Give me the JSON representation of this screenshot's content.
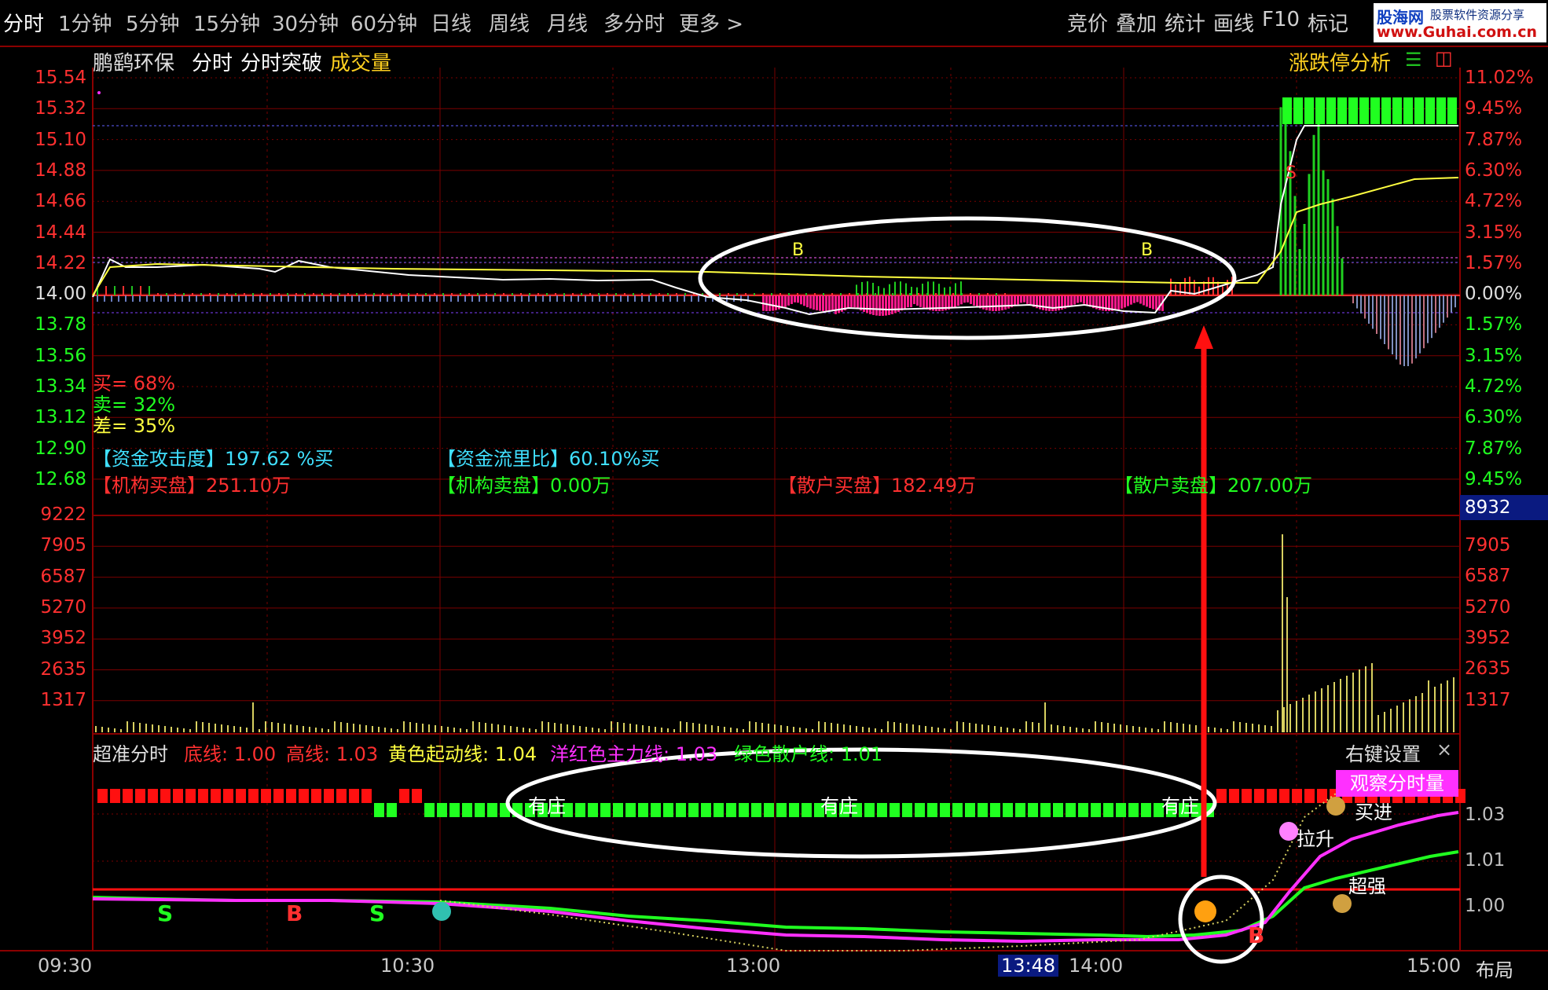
{
  "tabs": [
    "分时",
    "1分钟",
    "5分钟",
    "15分钟",
    "30分钟",
    "60分钟",
    "日线",
    "周线",
    "月线",
    "多分时",
    "更多 >"
  ],
  "toolbar": [
    "竞价",
    "叠加",
    "统计",
    "画线",
    "F10",
    "标记"
  ],
  "logo": {
    "line1": "股海网",
    "line1b": "股票软件资源分享",
    "line2": "www.Guhai.com.cn"
  },
  "chart_header": {
    "stock": "鹏鹞环保",
    "view": "分时",
    "indicator": "分时突破",
    "volume": "成交量",
    "right_label": "涨跌停分析"
  },
  "price_axis": [
    "15.54",
    "15.32",
    "15.10",
    "14.88",
    "14.66",
    "14.44",
    "14.22",
    "14.00",
    "13.78",
    "13.56",
    "13.34",
    "13.12",
    "12.90",
    "12.68"
  ],
  "pct_axis": [
    "11.02%",
    "9.45%",
    "7.87%",
    "6.30%",
    "4.72%",
    "3.15%",
    "1.57%",
    "0.00%",
    "1.57%",
    "3.15%",
    "4.72%",
    "6.30%",
    "7.87%",
    "9.45%"
  ],
  "ratios": {
    "buy": "买= 68%",
    "sell": "卖= 32%",
    "diff": "差= 35%"
  },
  "fund_stats": {
    "attack": "【资金攻击度】197.62 %买",
    "flow": "【资金流里比】60.10%买",
    "inst_buy": "【机构买盘】251.10万",
    "inst_sell": "【机构卖盘】0.00万",
    "retail_buy": "【散户买盘】182.49万",
    "retail_sell": "【散户卖盘】207.00万"
  },
  "volume_axis": [
    "9222",
    "7905",
    "6587",
    "5270",
    "3952",
    "2635",
    "1317"
  ],
  "volume_axis_right": [
    "7905",
    "6587",
    "5270",
    "3952",
    "2635",
    "1317"
  ],
  "volume_badge": "8932",
  "indicator_panel": {
    "name": "超准分时",
    "low": "底线: 1.00",
    "high": "高线: 1.03",
    "yellow": "黄色起动线: 1.04",
    "magenta": "洋红色主力线: 1.03",
    "green": "绿色散户线: 1.01",
    "settings": "右键设置",
    "close": "×",
    "observe": "观察分时量",
    "zhuang": [
      "有庄",
      "有庄",
      "有庄"
    ],
    "signals": [
      "买进",
      "拉升",
      "超强"
    ],
    "axis": [
      "1.03",
      "1.01",
      "1.00"
    ]
  },
  "markers": {
    "b1": "B",
    "b2": "B",
    "s1": "S",
    "s2": "S",
    "b_red": "B",
    "b_red2": "B",
    "la": "拉升"
  },
  "time_axis": [
    "09:30",
    "10:30",
    "13:00",
    "13:48",
    "14:00",
    "15:00"
  ],
  "layout_button": "布局",
  "colors": {
    "bg": "#000000",
    "grid": "#8b0000",
    "up": "#ff3030",
    "down": "#20ff20",
    "avg": "#ffff40",
    "price": "#ffffff",
    "magenta": "#ff30ff",
    "cyan": "#40e0ff"
  }
}
